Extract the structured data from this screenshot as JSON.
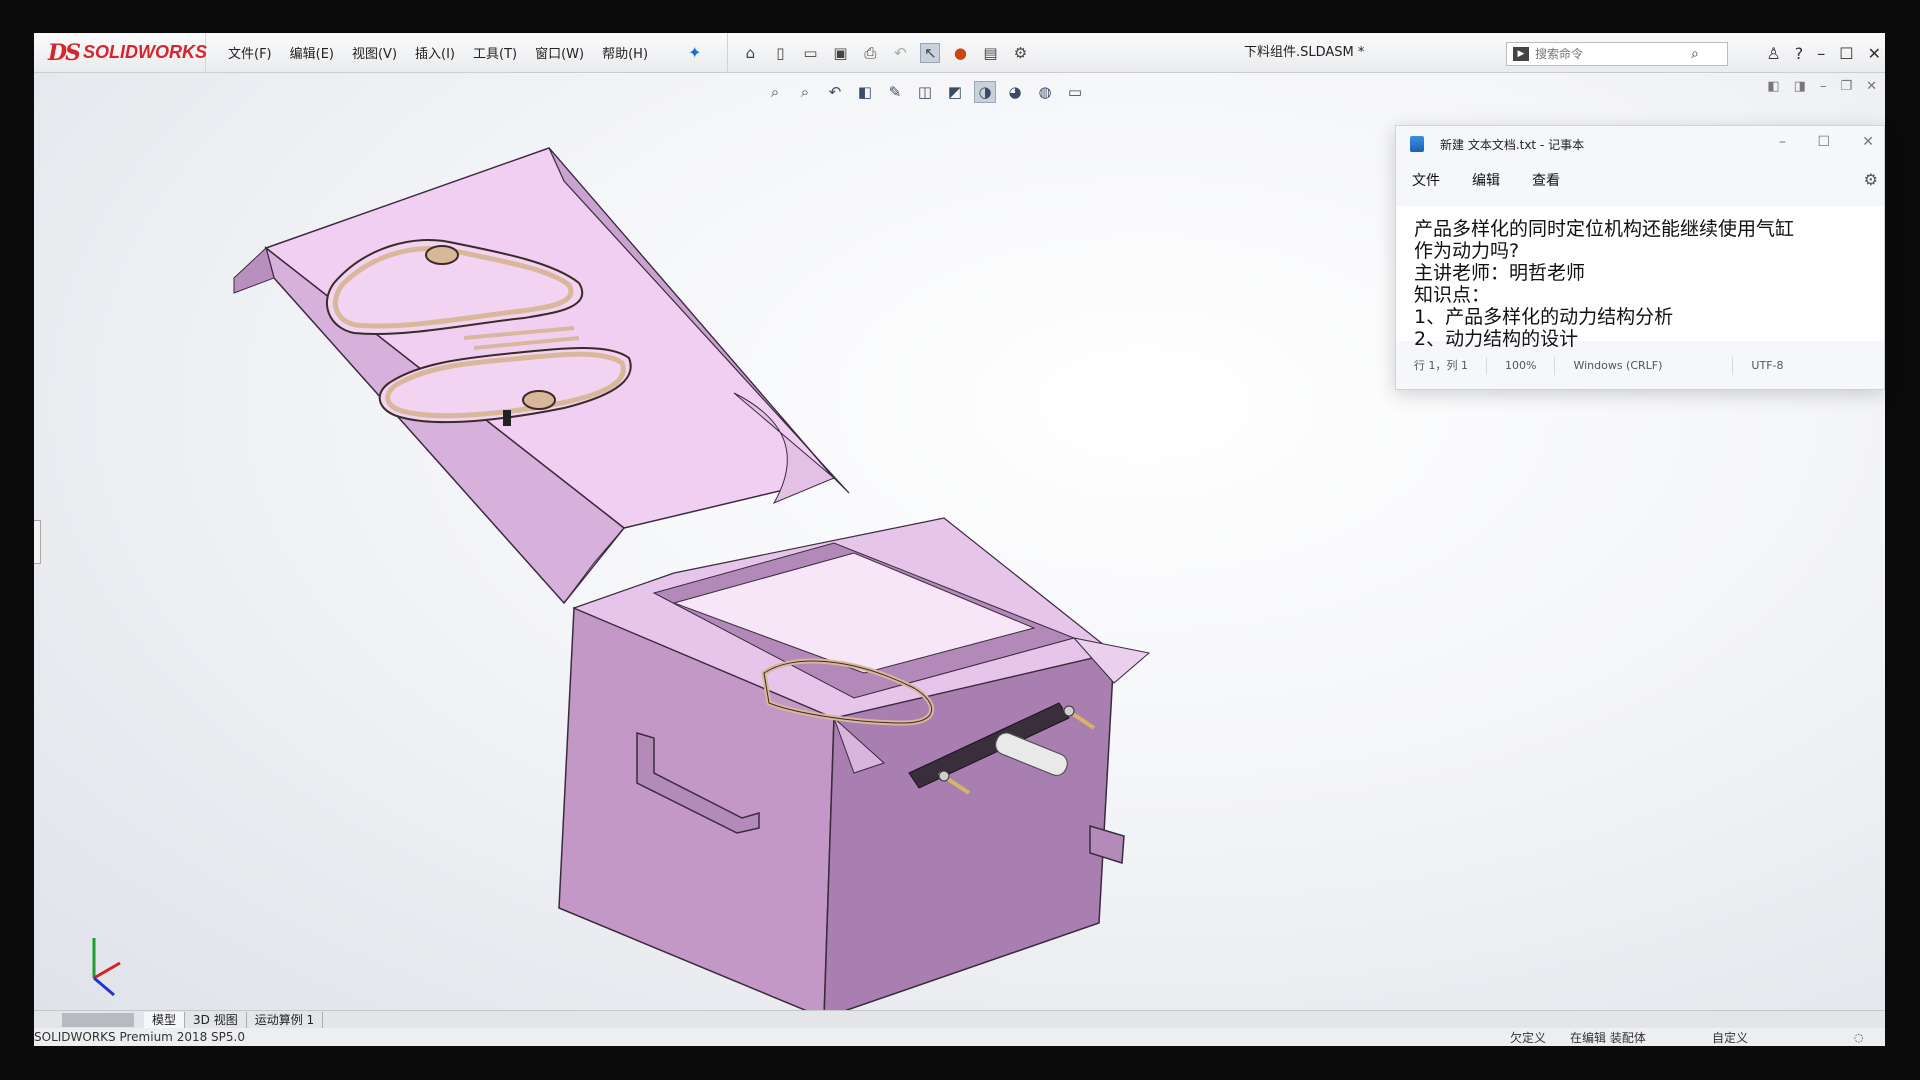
{
  "app": {
    "logo_ds": "DS",
    "logo_text": "SOLIDWORKS",
    "document_title": "下料组件.SLDASM *"
  },
  "menu": {
    "items": [
      "文件(F)",
      "编辑(E)",
      "视图(V)",
      "插入(I)",
      "工具(T)",
      "窗口(W)",
      "帮助(H)"
    ]
  },
  "search": {
    "placeholder": "搜索命令"
  },
  "tabs": {
    "items": [
      "模型",
      "3D 视图",
      "运动算例 1"
    ]
  },
  "status": {
    "product": "SOLIDWORKS Premium 2018 SP5.0",
    "state1": "欠定义",
    "state2": "在编辑 装配体",
    "state3": "自定义"
  },
  "notepad": {
    "title": "新建 文本文档.txt - 记事本",
    "menu": [
      "文件",
      "编辑",
      "查看"
    ],
    "lines": [
      "产品多样化的同时定位机构还能继续使用气缸",
      "作为动力吗?",
      "主讲老师：明哲老师",
      "知识点：",
      "1、产品多样化的动力结构分析",
      "2、动力结构的设计"
    ],
    "status": {
      "position": "行 1，列 1",
      "zoom": "100%",
      "line_ending": "Windows (CRLF)",
      "encoding": "UTF-8"
    }
  },
  "colors": {
    "model_face_light": "#f2d3f2",
    "model_face_mid": "#c49ac8",
    "model_face_dark": "#9e76a6",
    "hanger": "#d9b79a",
    "brand_red": "#d4262c"
  }
}
